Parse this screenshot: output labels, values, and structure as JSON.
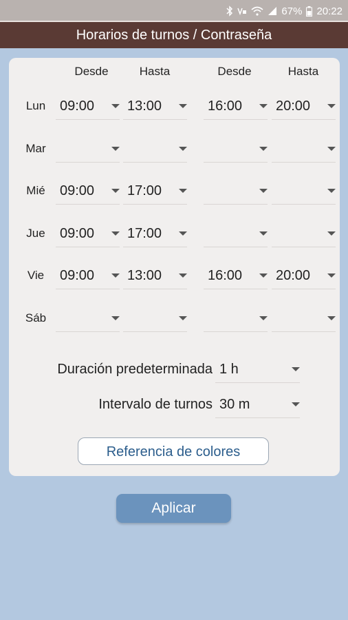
{
  "status_bar": {
    "battery": "67%",
    "time": "20:22"
  },
  "title": "Horarios de turnos / Contraseña",
  "columns": [
    "Desde",
    "Hasta",
    "Desde",
    "Hasta"
  ],
  "days": [
    {
      "label": "Lun",
      "slots": [
        "09:00",
        "13:00",
        "16:00",
        "20:00"
      ]
    },
    {
      "label": "Mar",
      "slots": [
        "",
        "",
        "",
        ""
      ]
    },
    {
      "label": "Mié",
      "slots": [
        "09:00",
        "17:00",
        "",
        ""
      ]
    },
    {
      "label": "Jue",
      "slots": [
        "09:00",
        "17:00",
        "",
        ""
      ]
    },
    {
      "label": "Vie",
      "slots": [
        "09:00",
        "13:00",
        "16:00",
        "20:00"
      ]
    },
    {
      "label": "Sáb",
      "slots": [
        "",
        "",
        "",
        ""
      ]
    }
  ],
  "duration": {
    "label": "Duración predeterminada",
    "value": "1 h"
  },
  "interval": {
    "label": "Intervalo de turnos",
    "value": "30 m"
  },
  "color_ref_button": "Referencia de colores",
  "apply_button": "Aplicar"
}
